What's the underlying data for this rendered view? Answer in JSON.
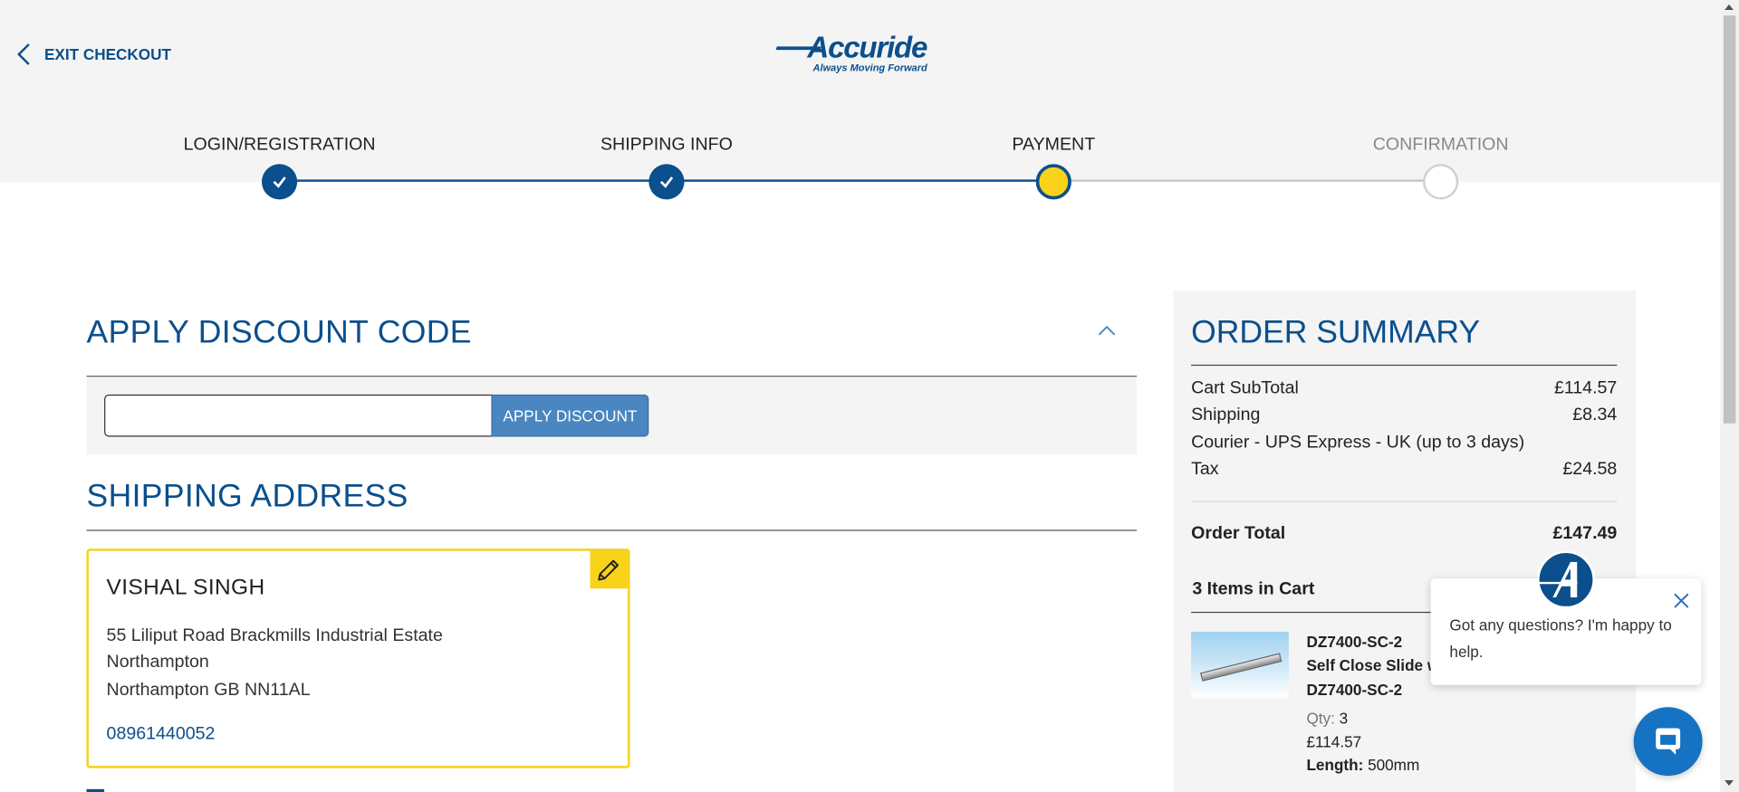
{
  "header": {
    "exit_label": "EXIT CHECKOUT",
    "logo_text": "Accuride",
    "logo_tagline": "Always Moving Forward"
  },
  "steps": [
    {
      "label": "LOGIN/REGISTRATION",
      "state": "done"
    },
    {
      "label": "SHIPPING INFO",
      "state": "done"
    },
    {
      "label": "PAYMENT",
      "state": "current"
    },
    {
      "label": "CONFIRMATION",
      "state": "todo"
    }
  ],
  "discount": {
    "title": "APPLY DISCOUNT CODE",
    "input_value": "",
    "button_label": "APPLY DISCOUNT"
  },
  "shipping": {
    "title": "SHIPPING ADDRESS",
    "name": "VISHAL SINGH",
    "address_line1": "55 Liliput Road Brackmills Industrial Estate",
    "address_line2": "Northampton",
    "address_line3": "Northampton GB NN11AL",
    "phone": "08961440052"
  },
  "summary": {
    "title": "ORDER SUMMARY",
    "subtotal_label": "Cart SubTotal",
    "subtotal_value": "£114.57",
    "shipping_label": "Shipping",
    "shipping_value": "£8.34",
    "shipping_method": "Courier - UPS Express - UK (up to 3 days)",
    "tax_label": "Tax",
    "tax_value": "£24.58",
    "total_label": "Order Total",
    "total_value": "£147.49",
    "items_title": "3 Items in Cart",
    "item": {
      "code": "DZ7400-SC-2",
      "name": "Self Close Slide w",
      "code2": "DZ7400-SC-2",
      "qty_label": "Qty:",
      "qty_value": "3",
      "price": "£114.57",
      "length_label": "Length:",
      "length_value": "500mm"
    }
  },
  "chat": {
    "message": "Got any questions? I'm happy to help."
  },
  "colors": {
    "brand_blue": "#0b4f8c",
    "accent_yellow": "#f8d31a",
    "button_blue": "#4a86c0"
  }
}
